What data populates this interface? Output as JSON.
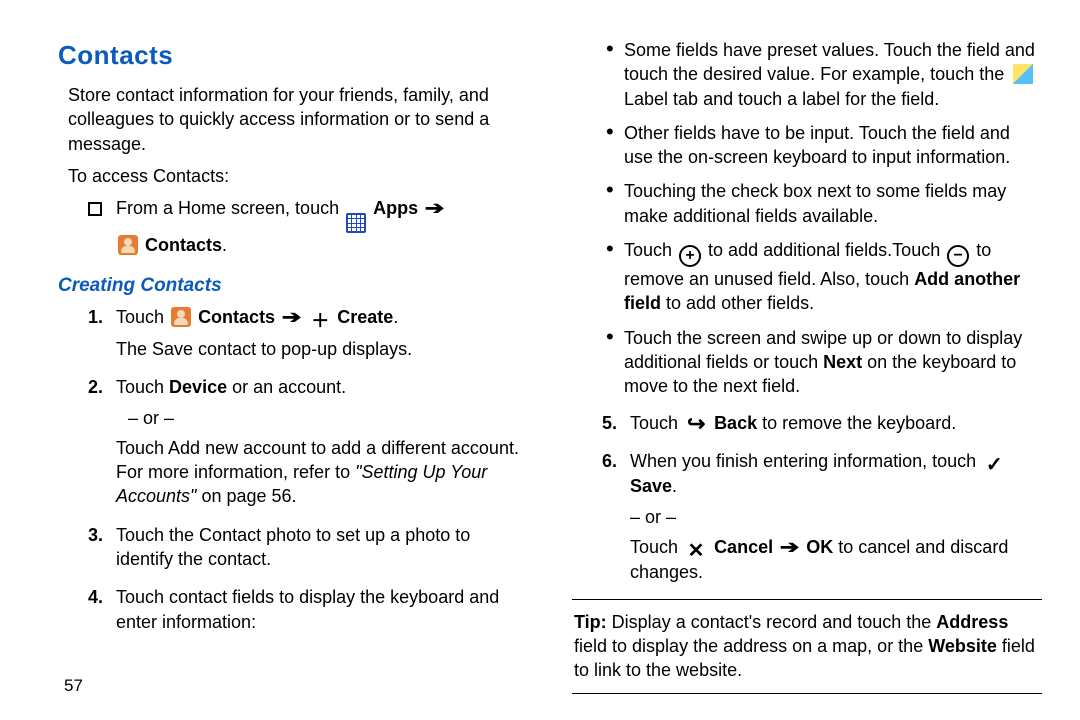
{
  "heading": "Contacts",
  "intro": "Store contact information for your friends, family, and colleagues to quickly access information or to send a message.",
  "access_lead": "To access Contacts:",
  "square_line": {
    "pre": "From a Home screen, touch ",
    "apps": "Apps",
    "arrow": "➔",
    "contacts": "Contacts",
    "end": "."
  },
  "subheading": "Creating Contacts",
  "steps": {
    "s1": {
      "pre": "Touch ",
      "contacts": "Contacts",
      "arrow": "➔",
      "create": "Create",
      "end": ".",
      "line2": "The Save contact to pop-up displays."
    },
    "s2": {
      "line1a": "Touch ",
      "device": "Device",
      "line1b": " or an account.",
      "or": "– or –",
      "line2a": "Touch Add new account to add a different account. For more information, refer to ",
      "ref": "\"Setting Up Your Accounts\"",
      "line2b": " on page 56."
    },
    "s3": "Touch the Contact photo to set up a photo to identify the contact.",
    "s4": "Touch contact fields to display the keyboard and enter information:"
  },
  "bullets": {
    "b1a": "Some fields have preset values. Touch the field and touch the desired value. For example, touch the ",
    "b1b": " Label tab and touch a label for the field.",
    "b2": "Other fields have to be input. Touch the field and use the on-screen keyboard to input information.",
    "b3": "Touching the check box next to some fields may make additional fields available.",
    "b4a": "Touch ",
    "b4b": " to add additional fields.Touch ",
    "b4c": " to remove an unused field. Also, touch ",
    "b4_add": "Add another field",
    "b4d": " to add other fields.",
    "b5a": "Touch the screen and swipe up or down to display additional fields or touch ",
    "b5_next": "Next",
    "b5b": " on the keyboard to move to the next field."
  },
  "steps_right": {
    "s5a": "Touch ",
    "s5_back": "Back",
    "s5b": " to remove the keyboard.",
    "s6a": "When you finish entering information, touch ",
    "s6_save": "Save",
    "s6b": ".",
    "or": "– or –",
    "s6c": "Touch ",
    "cancel": "Cancel",
    "arrow": "➔",
    "ok": "OK",
    "s6d": " to cancel and discard changes."
  },
  "tip": {
    "label": "Tip:",
    "a": " Display a contact's record and touch the ",
    "address": "Address",
    "b": " field to display the address on a map, or the ",
    "website": "Website",
    "c": " field to link to the website."
  },
  "page_no": "57"
}
